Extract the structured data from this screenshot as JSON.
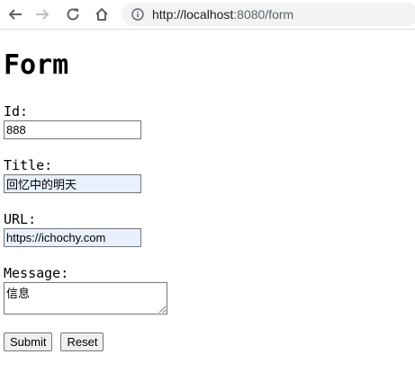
{
  "browser": {
    "url_host": "http://localhost",
    "url_rest": ":8080/form"
  },
  "page": {
    "title": "Form"
  },
  "form": {
    "id": {
      "label": "Id:",
      "value": "888"
    },
    "title": {
      "label": "Title:",
      "value": "回忆中的明天"
    },
    "url": {
      "label": "URL:",
      "value": "https://ichochy.com"
    },
    "message": {
      "label": "Message:",
      "value": "信息"
    },
    "submit_label": "Submit",
    "reset_label": "Reset"
  }
}
